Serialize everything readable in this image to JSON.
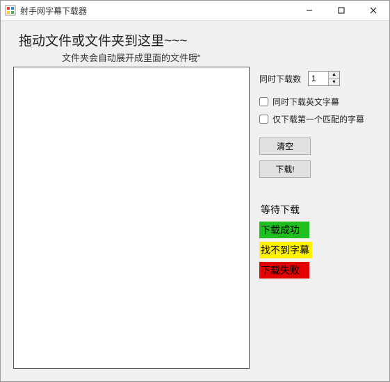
{
  "window": {
    "title": "射手网字幕下载器"
  },
  "heading": "拖动文件或文件夹到这里~~~",
  "subheading": "文件夹会自动展开成里面的文件哦\"",
  "sidepanel": {
    "concurrent_label": "同时下载数",
    "concurrent_value": "1",
    "checkbox_english": "同时下载英文字幕",
    "checkbox_firstmatch": "仅下载第一个匹配的字幕",
    "button_clear": "清空",
    "button_download": "下载!"
  },
  "legend": {
    "waiting": "等待下载",
    "success": "下载成功",
    "notfound": "找不到字幕",
    "failed": "下载失败"
  }
}
